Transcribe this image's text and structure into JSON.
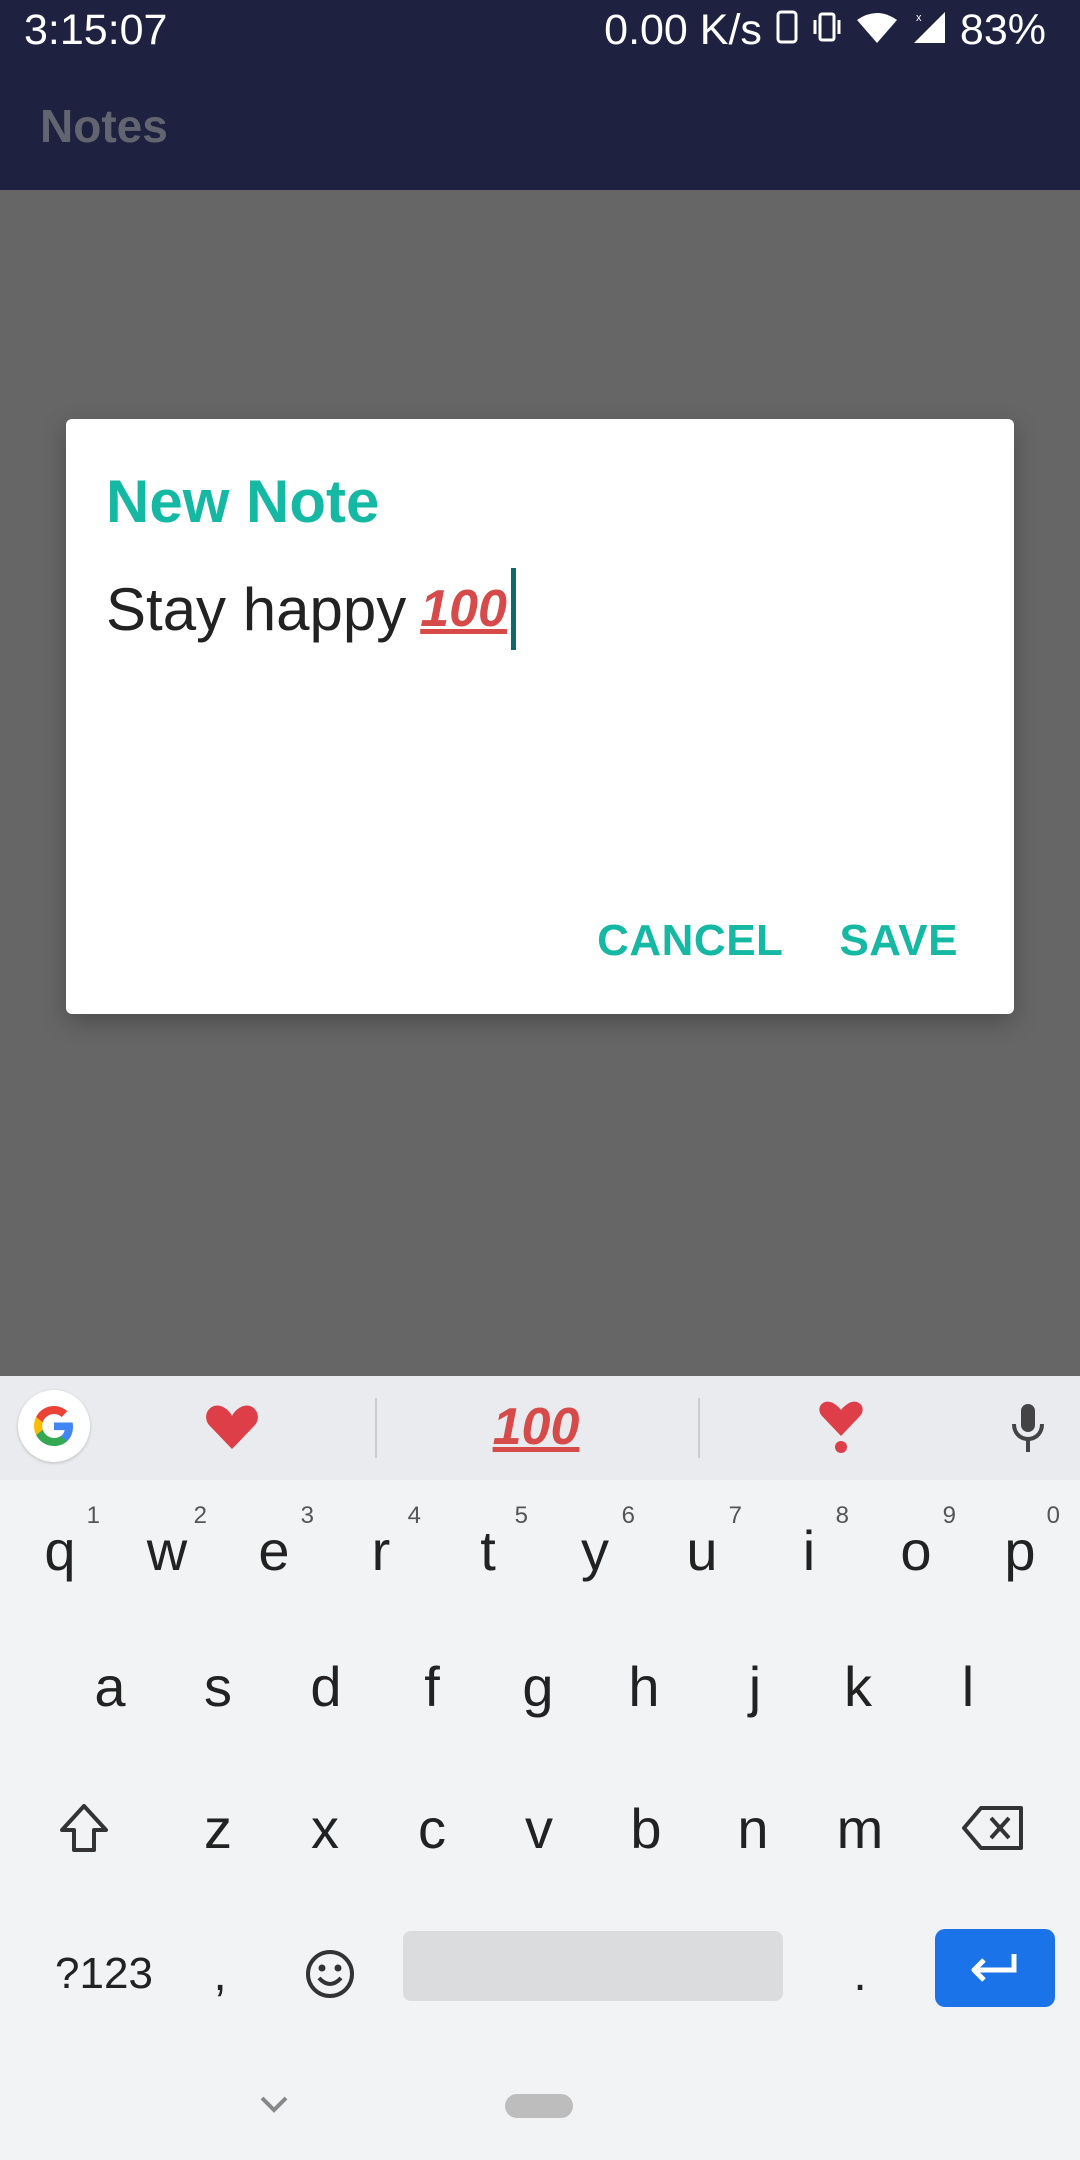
{
  "status_bar": {
    "time": "3:15:07",
    "network_speed": "0.00 K/s",
    "battery": "83%",
    "icons": [
      "phone-icon",
      "vibrate-icon",
      "wifi-icon",
      "signal-icon"
    ]
  },
  "app_bar": {
    "title": "Notes"
  },
  "dialog": {
    "title": "New Note",
    "note_text": "Stay happy",
    "note_emoji": "100",
    "cancel_label": "CANCEL",
    "save_label": "SAVE"
  },
  "fab": {
    "label": "+"
  },
  "keyboard": {
    "suggestions": [
      "heart-emoji",
      "hundred-points-emoji",
      "heart-exclamation-emoji"
    ],
    "hundred_text": "100",
    "row1": [
      {
        "key": "q",
        "hint": "1"
      },
      {
        "key": "w",
        "hint": "2"
      },
      {
        "key": "e",
        "hint": "3"
      },
      {
        "key": "r",
        "hint": "4"
      },
      {
        "key": "t",
        "hint": "5"
      },
      {
        "key": "y",
        "hint": "6"
      },
      {
        "key": "u",
        "hint": "7"
      },
      {
        "key": "i",
        "hint": "8"
      },
      {
        "key": "o",
        "hint": "9"
      },
      {
        "key": "p",
        "hint": "0"
      }
    ],
    "row2": [
      "a",
      "s",
      "d",
      "f",
      "g",
      "h",
      "j",
      "k",
      "l"
    ],
    "row3": [
      "z",
      "x",
      "c",
      "v",
      "b",
      "n",
      "m"
    ],
    "symbols_label": "?123",
    "comma_label": ",",
    "period_label": "."
  },
  "colors": {
    "accent": "#15b9a3",
    "app_bar": "#1e2240",
    "fab": "#0b6758",
    "enter_key": "#1a73e8"
  }
}
